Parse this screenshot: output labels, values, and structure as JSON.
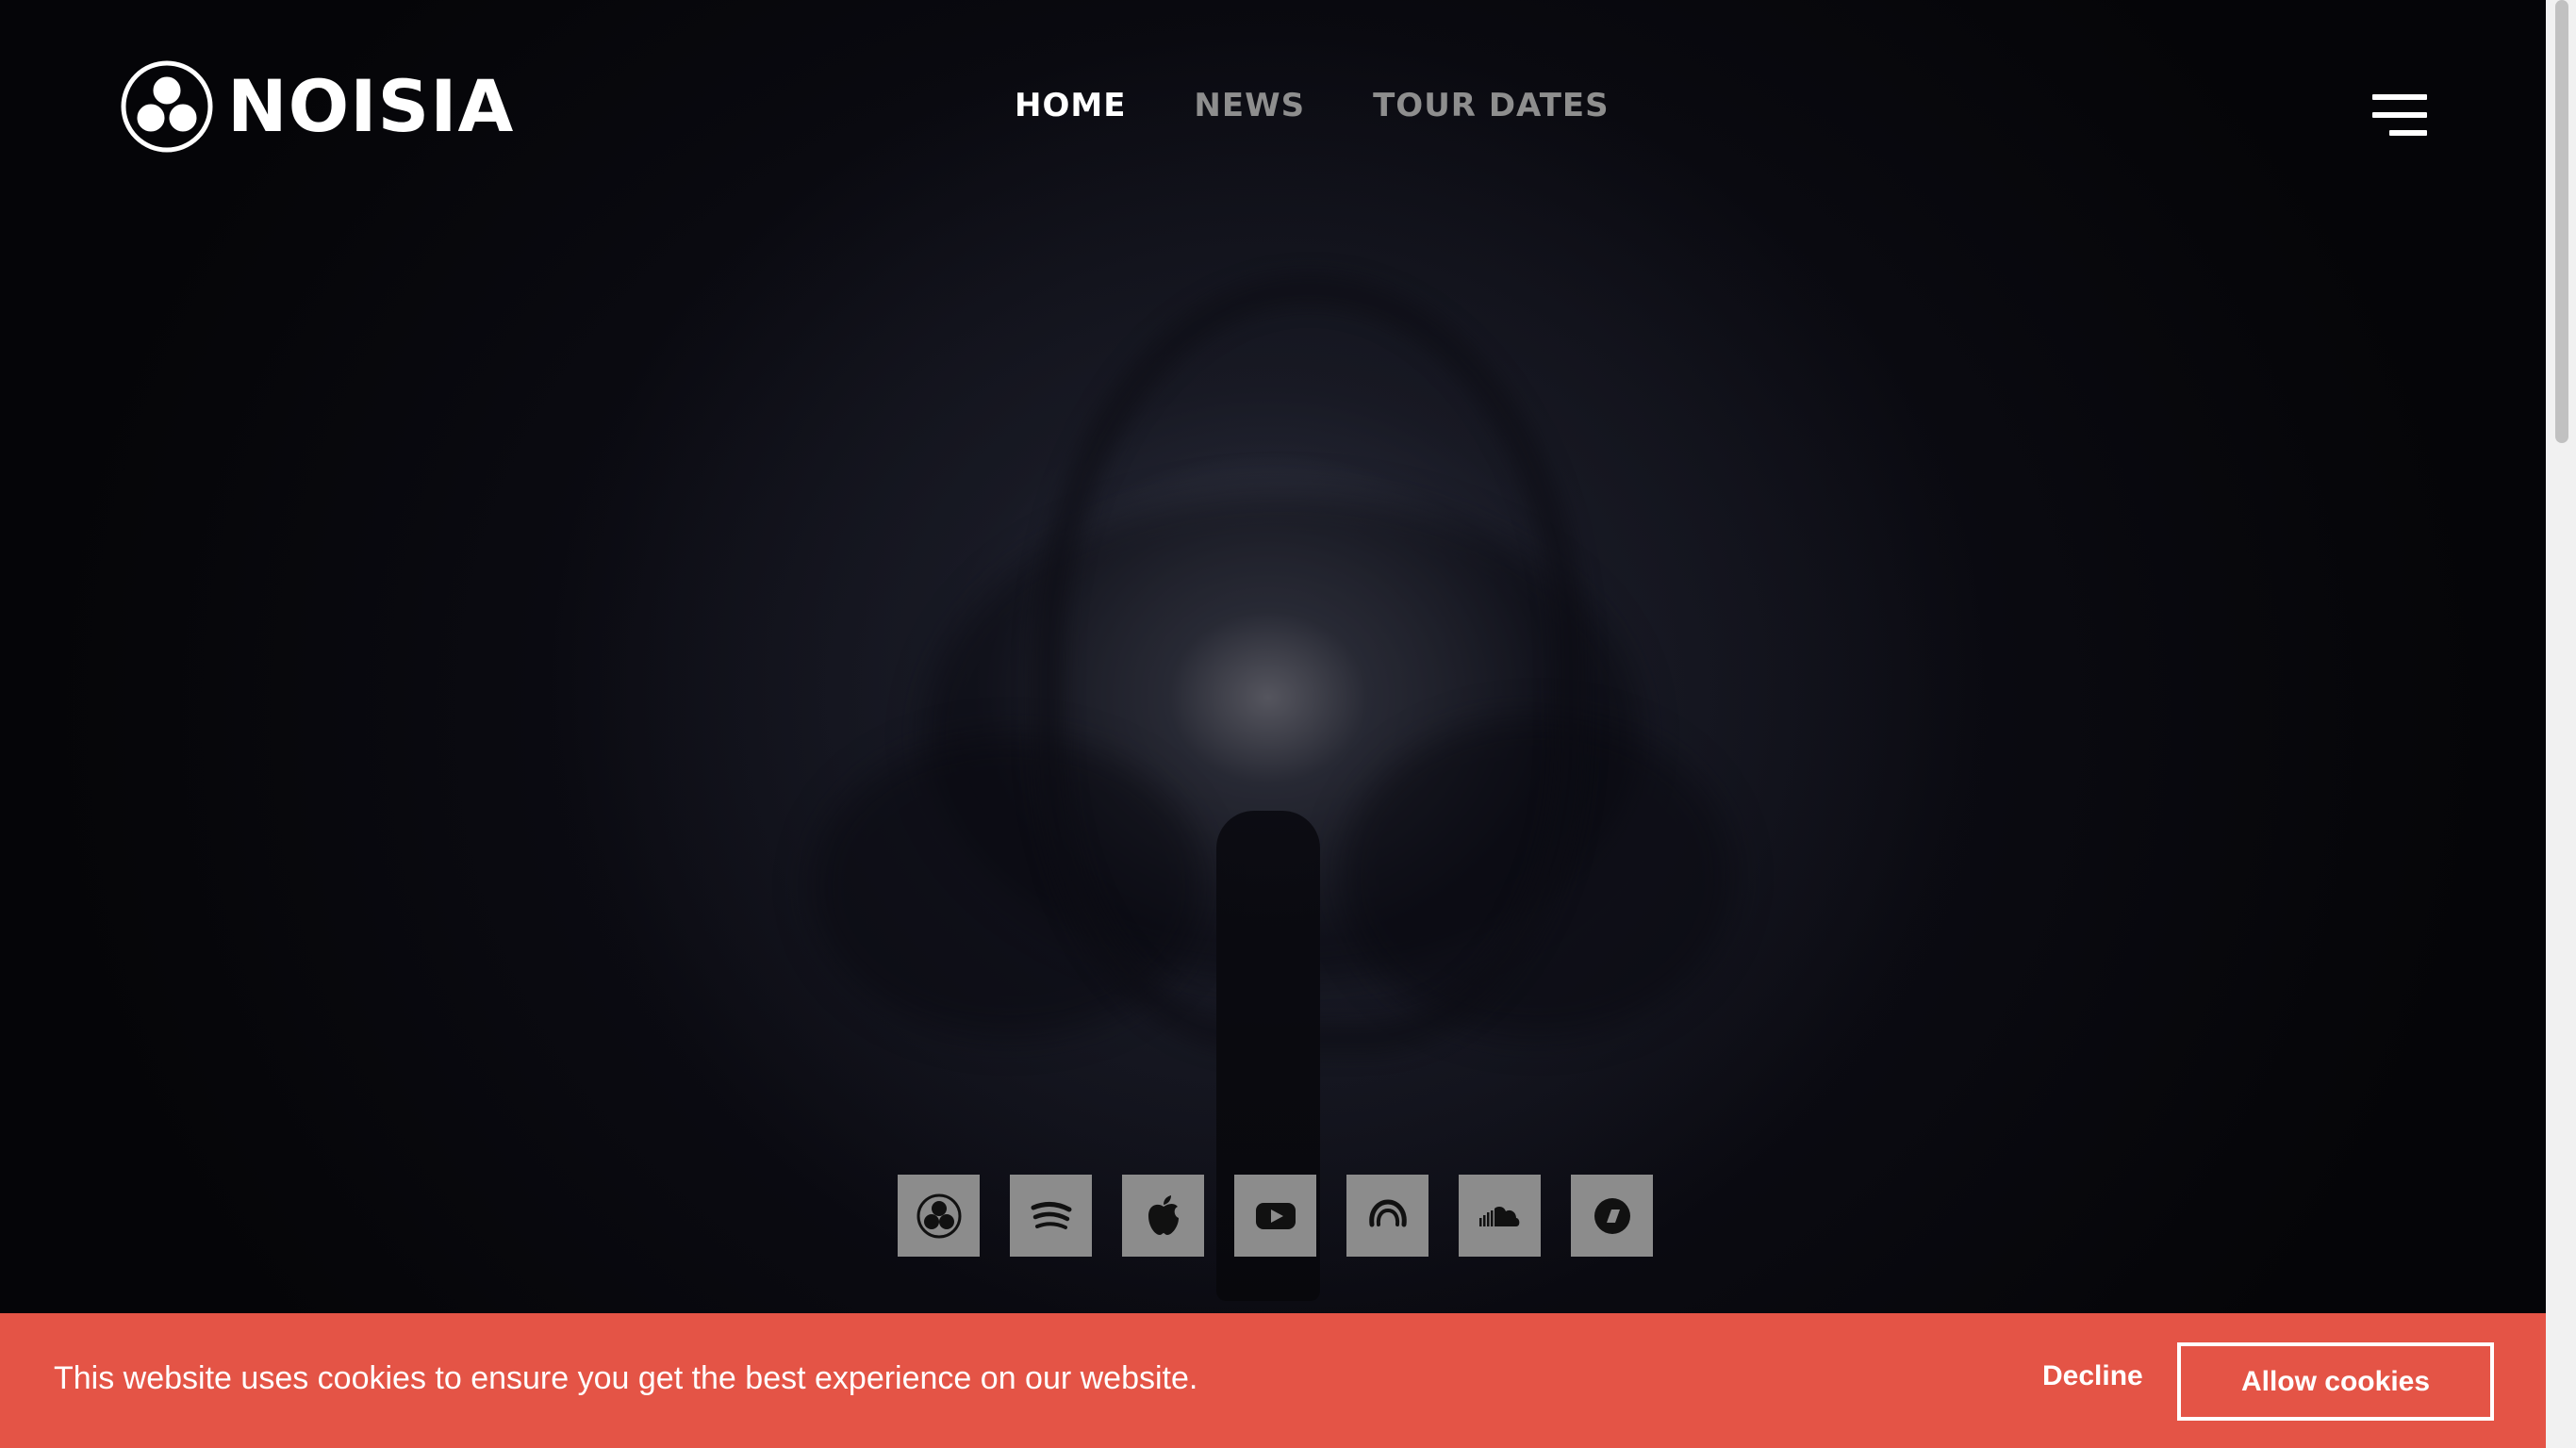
{
  "brand": {
    "name": "NOISIA"
  },
  "nav": {
    "items": [
      {
        "label": "HOME",
        "active": true
      },
      {
        "label": "NEWS",
        "active": false
      },
      {
        "label": "TOUR DATES",
        "active": false
      }
    ]
  },
  "social": {
    "icons": [
      "noisia-icon",
      "spotify-icon",
      "apple-music-icon",
      "youtube-icon",
      "audiomack-icon",
      "soundcloud-icon",
      "bandcamp-icon"
    ],
    "button_color": "#8c8c8c"
  },
  "cookie_bar": {
    "message": "This website uses cookies to ensure you get the best experience on our website.",
    "decline_label": "Decline",
    "allow_label": "Allow cookies",
    "background_color": "#e45446"
  }
}
